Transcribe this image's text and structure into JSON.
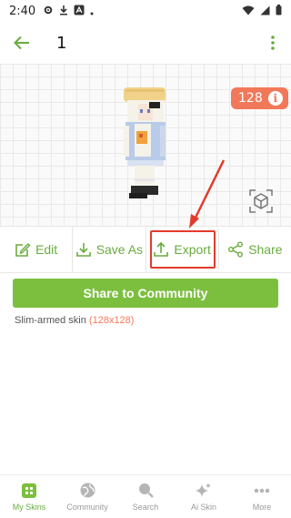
{
  "status": {
    "time": "2:40"
  },
  "header": {
    "title": "1"
  },
  "preview": {
    "badge_count": "128",
    "badge_info": "i"
  },
  "actions": [
    {
      "label": "Edit",
      "icon": "edit-icon"
    },
    {
      "label": "Save As",
      "icon": "download-icon"
    },
    {
      "label": "Export",
      "icon": "upload-icon"
    },
    {
      "label": "Share",
      "icon": "share-icon"
    }
  ],
  "share_community_label": "Share to Community",
  "skin_info": {
    "type": "Slim-armed skin",
    "size": "(128x128)"
  },
  "bottom_nav": [
    {
      "label": "My Skins",
      "icon": "grid-icon",
      "active": true
    },
    {
      "label": "Community",
      "icon": "globe-icon",
      "active": false
    },
    {
      "label": "Search",
      "icon": "search-icon",
      "active": false
    },
    {
      "label": "Ai Skin",
      "icon": "sparkle-icon",
      "active": false
    },
    {
      "label": "More",
      "icon": "more-icon",
      "active": false
    }
  ],
  "colors": {
    "accent": "#7cbf3f",
    "badge": "#f2785a",
    "highlight": "#e23b2c"
  }
}
